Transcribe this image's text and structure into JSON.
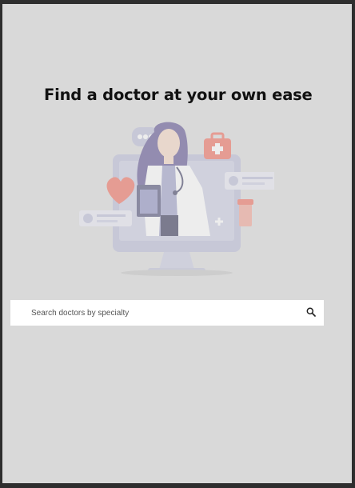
{
  "hero": {
    "headline": "Find a doctor at your own ease"
  },
  "illustration": {
    "icon": "doctor-on-monitor-illustration"
  },
  "search": {
    "value": "",
    "placeholder": "Search doctors by specialty",
    "icon": "search-icon"
  },
  "colors": {
    "background": "#d9d9d9",
    "frame": "#2e2e2e",
    "headline": "#111111",
    "search_bg": "#ffffff"
  }
}
